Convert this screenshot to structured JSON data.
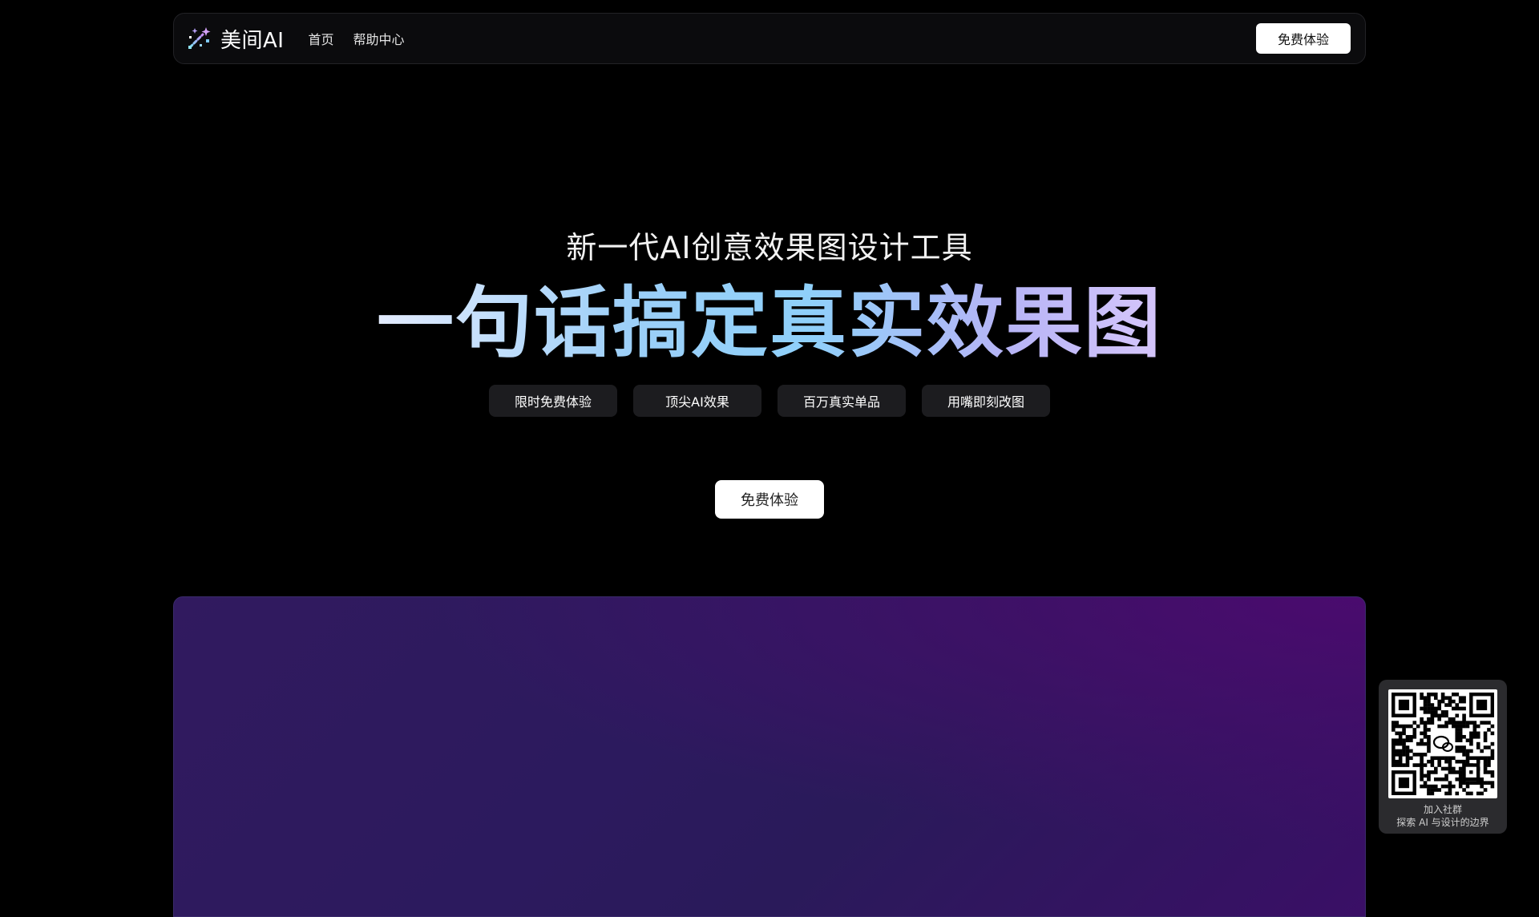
{
  "brand": {
    "name": "美间AI",
    "accent_colors": [
      "#e4ecff",
      "#9ccff8",
      "#8fd0fa",
      "#b6b4f6",
      "#d6c6fb"
    ]
  },
  "nav": {
    "links": [
      {
        "label": "首页"
      },
      {
        "label": "帮助中心"
      }
    ],
    "cta_label": "免费体验"
  },
  "hero": {
    "subtitle": "新一代AI创意效果图设计工具",
    "title": "一句话搞定真实效果图",
    "tags": [
      "限时免费体验",
      "顶尖AI效果",
      "百万真实单品",
      "用嘴即刻改图"
    ],
    "cta_label": "免费体验"
  },
  "qr_widget": {
    "line1": "加入社群",
    "line2": "探索 AI 与设计的边界",
    "icon": "wechat-icon"
  }
}
